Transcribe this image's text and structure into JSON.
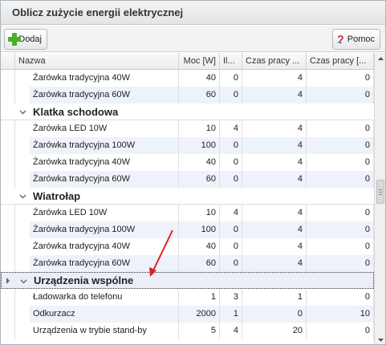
{
  "window": {
    "title": "Oblicz zużycie energii elektrycznej"
  },
  "toolbar": {
    "add_label": "Dodaj",
    "help_label": "Pomoc"
  },
  "columns": {
    "name": "Nazwa",
    "moc": "Moc [W]",
    "ilosc": "Il...",
    "czas1": "Czas pracy ...",
    "czas2": "Czas pracy [..."
  },
  "rows": [
    {
      "type": "item",
      "name": "Żarówka tradycyjna 40W",
      "moc": "40",
      "il": "0",
      "cz1": "4",
      "cz2": "0",
      "alt": false
    },
    {
      "type": "item",
      "name": "Żarówka tradycyjna 60W",
      "moc": "60",
      "il": "0",
      "cz1": "4",
      "cz2": "0",
      "alt": true
    },
    {
      "type": "group",
      "name": "Klatka schodowa"
    },
    {
      "type": "item",
      "name": "Żarówka LED 10W",
      "moc": "10",
      "il": "4",
      "cz1": "4",
      "cz2": "0",
      "alt": false
    },
    {
      "type": "item",
      "name": "Żarówka tradycyjna 100W",
      "moc": "100",
      "il": "0",
      "cz1": "4",
      "cz2": "0",
      "alt": true
    },
    {
      "type": "item",
      "name": "Żarówka tradycyjna 40W",
      "moc": "40",
      "il": "0",
      "cz1": "4",
      "cz2": "0",
      "alt": false
    },
    {
      "type": "item",
      "name": "Żarówka tradycyjna 60W",
      "moc": "60",
      "il": "0",
      "cz1": "4",
      "cz2": "0",
      "alt": true
    },
    {
      "type": "group",
      "name": "Wiatrołap"
    },
    {
      "type": "item",
      "name": "Żarówka LED 10W",
      "moc": "10",
      "il": "4",
      "cz1": "4",
      "cz2": "0",
      "alt": false
    },
    {
      "type": "item",
      "name": "Żarówka tradycyjna 100W",
      "moc": "100",
      "il": "0",
      "cz1": "4",
      "cz2": "0",
      "alt": true
    },
    {
      "type": "item",
      "name": "Żarówka tradycyjna 40W",
      "moc": "40",
      "il": "0",
      "cz1": "4",
      "cz2": "0",
      "alt": false
    },
    {
      "type": "item",
      "name": "Żarówka tradycyjna 60W",
      "moc": "60",
      "il": "0",
      "cz1": "4",
      "cz2": "0",
      "alt": true
    },
    {
      "type": "group",
      "name": "Urządzenia wspólne",
      "selected": true
    },
    {
      "type": "item",
      "name": "Ładowarka do telefonu",
      "moc": "1",
      "il": "3",
      "cz1": "1",
      "cz2": "0",
      "alt": false
    },
    {
      "type": "item",
      "name": "Odkurzacz",
      "moc": "2000",
      "il": "1",
      "cz1": "0",
      "cz2": "10",
      "alt": true
    },
    {
      "type": "item",
      "name": "Urządzenia w trybie stand-by",
      "moc": "5",
      "il": "4",
      "cz1": "20",
      "cz2": "0",
      "alt": false
    }
  ],
  "colors": {
    "selected_row": "#ebeef6",
    "alt_row": "#eef2fa",
    "annotation_arrow": "#e02020",
    "add_icon": "#4caf2a"
  },
  "icons": {
    "add": "plus-icon",
    "help": "help-question-icon",
    "expand": "chevron-down-icon",
    "row_pointer": "row-pointer-icon"
  }
}
